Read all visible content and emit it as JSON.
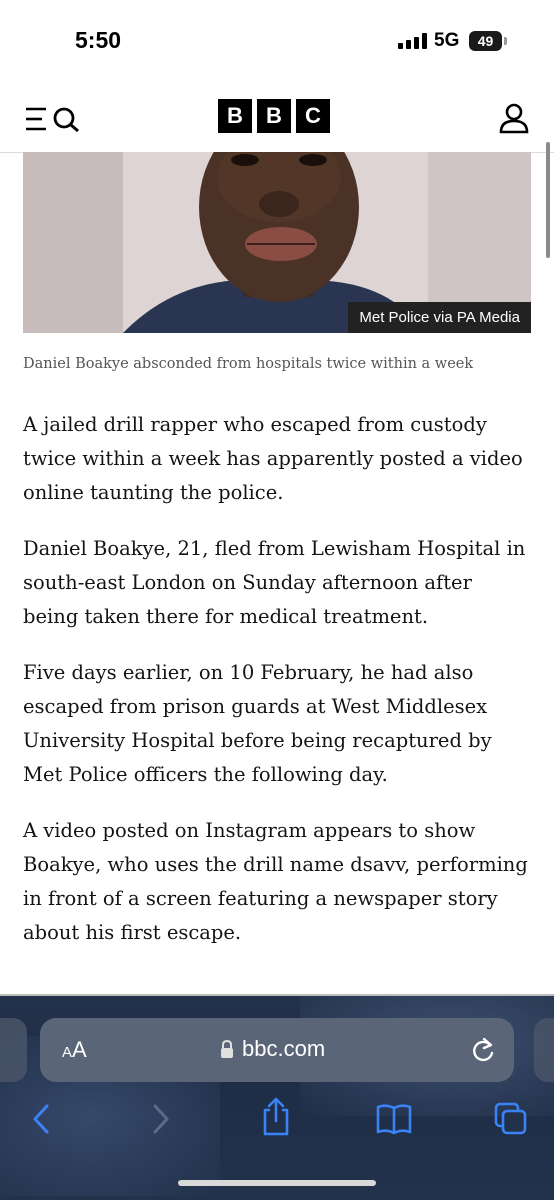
{
  "status_bar": {
    "time": "5:50",
    "network": "5G",
    "battery": "49"
  },
  "header": {
    "logo_letters": [
      "B",
      "B",
      "C"
    ],
    "icons": {
      "menu_search": "menu-search-icon",
      "account": "account-icon"
    }
  },
  "hero": {
    "credit": "Met Police via PA Media"
  },
  "caption": "Daniel Boakye absconded from hospitals twice within a week",
  "article": {
    "paragraphs": [
      "A jailed drill rapper who escaped from custody twice within a week has apparently posted a video online taunting the police.",
      "Daniel Boakye, 21, fled from Lewisham Hospital in south-east London on Sunday afternoon after being taken there for medical treatment.",
      "Five days earlier, on 10 February, he had also escaped from prison guards at West Middlesex University Hospital before being recaptured by Met Police officers the following day.",
      "A video posted on Instagram appears to show Boakye, who uses the drill name dsavv, performing in front of a screen featuring a newspaper story about his first escape."
    ]
  },
  "browser": {
    "text_size_label_small": "A",
    "text_size_label_large": "A",
    "url": "bbc.com",
    "accent": "#3b82f6",
    "icons": [
      "back-icon",
      "forward-icon",
      "share-icon",
      "bookmarks-icon",
      "tabs-icon",
      "reload-icon",
      "lock-icon"
    ]
  }
}
